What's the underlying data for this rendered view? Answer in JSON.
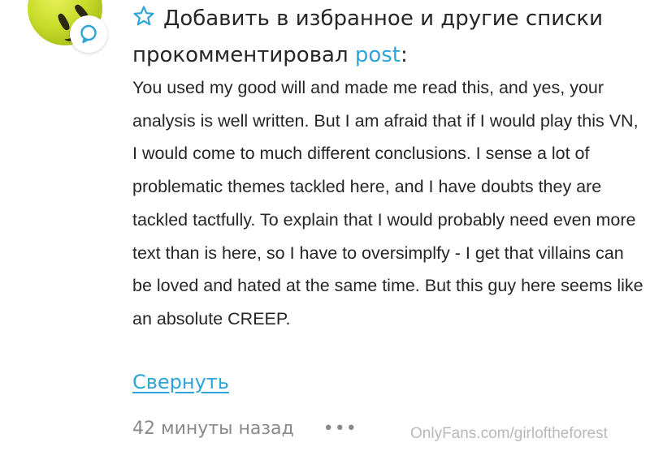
{
  "header": {
    "action_line": "Добавить в избранное и другие списки",
    "commented_prefix": "прокомментировал",
    "post_link": "post",
    "colon": ":"
  },
  "comment": {
    "text": "You used my good will and made me read this, and yes, your analysis is well written. But I am afraid that if I would play this VN, I would come to much different conclusions. I sense a lot of problematic themes tackled here, and I have doubts they are tackled tactfully. To explain that I would probably need even more text than is here, so I have to oversimplfy - I get that villains can be loved and hated at the same time. But this guy here seems like an absolute CREEP.",
    "collapse_label": "Свернуть"
  },
  "footer": {
    "timestamp": "42 минуты назад",
    "more_label": "•••"
  },
  "watermark": "OnlyFans.com/girloftheforest",
  "icons": {
    "star": "star-outline-icon",
    "comment": "comment-bubble-icon",
    "more": "more-dots-icon"
  },
  "colors": {
    "link": "#2ea4d8",
    "text": "#262626",
    "muted": "#8a8a8a",
    "avatar": "#c8dc2a"
  }
}
